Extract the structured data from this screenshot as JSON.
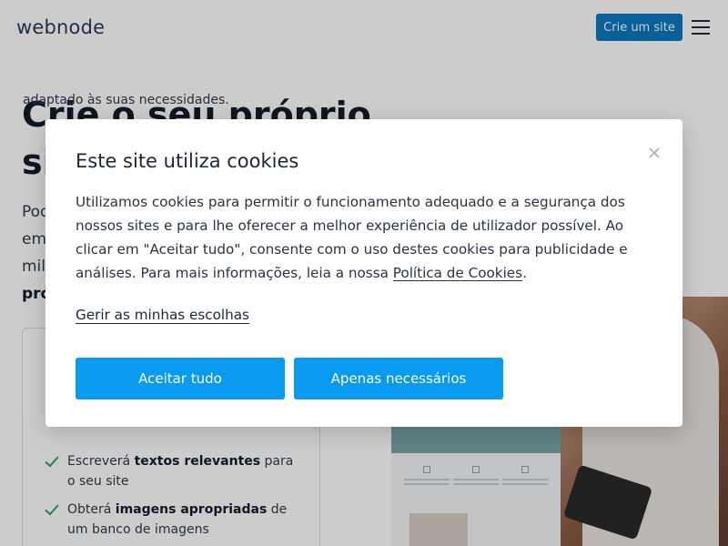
{
  "header": {
    "logo": "webnode",
    "cta_label": "Crie um site"
  },
  "hero": {
    "title": "Crie o seu próprio site",
    "desc_lines": [
      "Pod",
      "em",
      "mil",
      "pró"
    ]
  },
  "feature_card": {
    "intro": "adaptado às suas necessidades.",
    "items": [
      {
        "prefix": "Escreverá ",
        "bold": "textos relevantes",
        "suffix": " para o seu site"
      },
      {
        "prefix": "Obterá ",
        "bold": "imagens apropriadas",
        "suffix": " de um banco de imagens"
      }
    ]
  },
  "cookie_modal": {
    "title": "Este site utiliza cookies",
    "body": "Utilizamos cookies para permitir o funcionamento adequado e a segurança dos nossos sites e para lhe oferecer a melhor experiência de utilizador possível. Ao clicar em \"Aceitar tudo\", consente com o uso destes cookies para publicidade e análises. Para mais informações, leia a nossa ",
    "policy_link": "Política de Cookies",
    "policy_suffix": ".",
    "manage_link": "Gerir as minhas escolhas",
    "accept_all": "Aceitar tudo",
    "only_necessary": "Apenas necessários",
    "close_icon": "close-icon"
  },
  "colors": {
    "accent": "#0a9af0",
    "header_cta": "#0b78c2",
    "check": "#2fa84f"
  }
}
